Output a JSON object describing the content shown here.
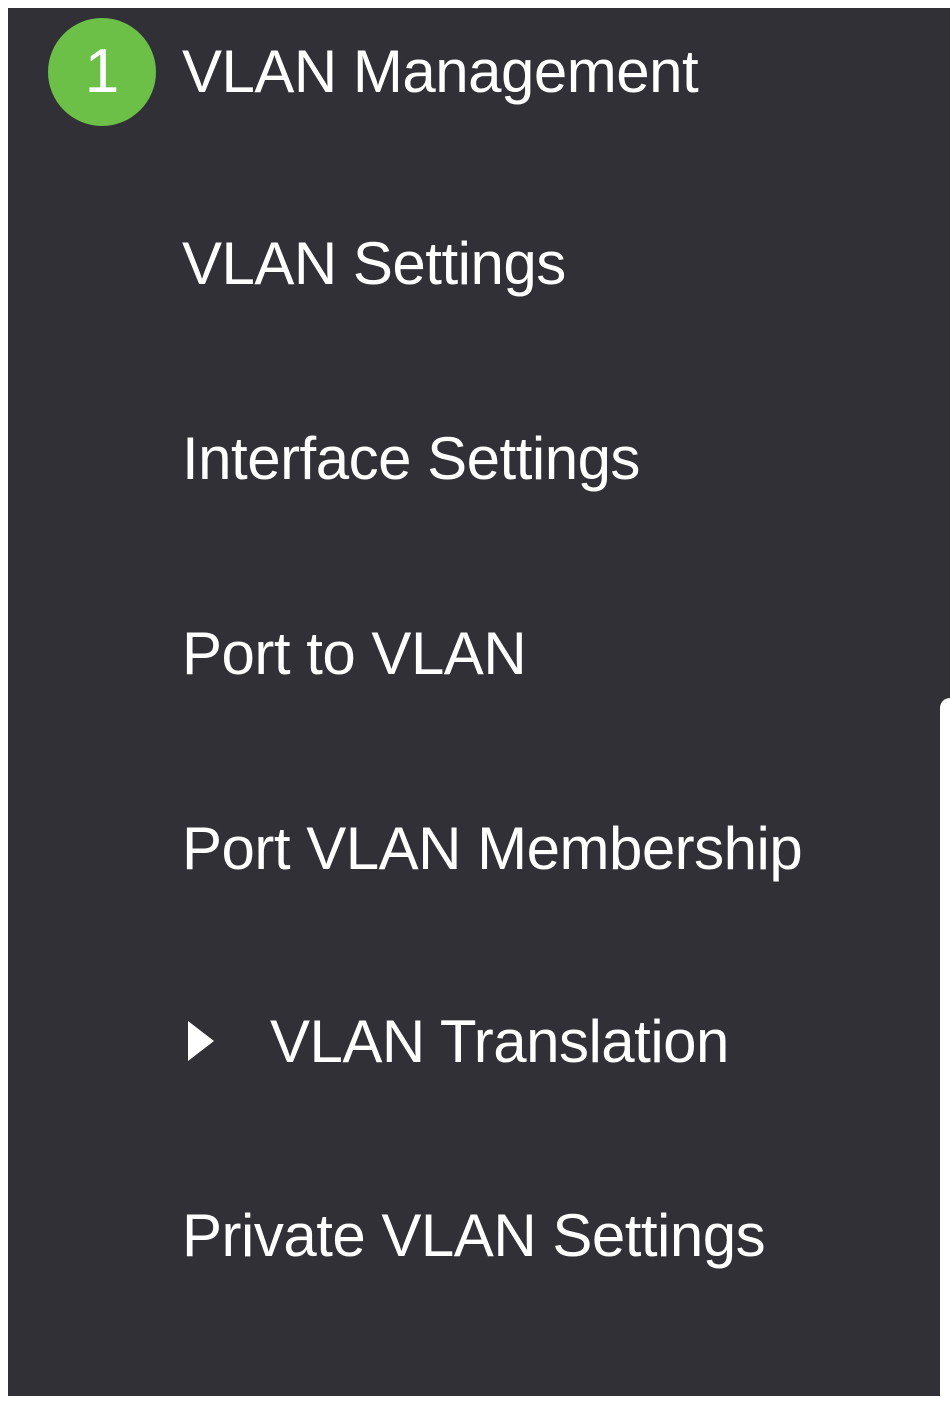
{
  "step_badge": {
    "number": "1",
    "color": "#6cbf47"
  },
  "sidebar": {
    "background": "#313036",
    "header": {
      "label": "VLAN Management"
    },
    "items": [
      {
        "label": "VLAN Settings"
      },
      {
        "label": "Interface Settings"
      },
      {
        "label": "Port to VLAN"
      },
      {
        "label": "Port VLAN Membership"
      },
      {
        "label": "VLAN Translation",
        "icon": "caret-right-icon"
      },
      {
        "label": "Private VLAN Settings"
      }
    ]
  }
}
